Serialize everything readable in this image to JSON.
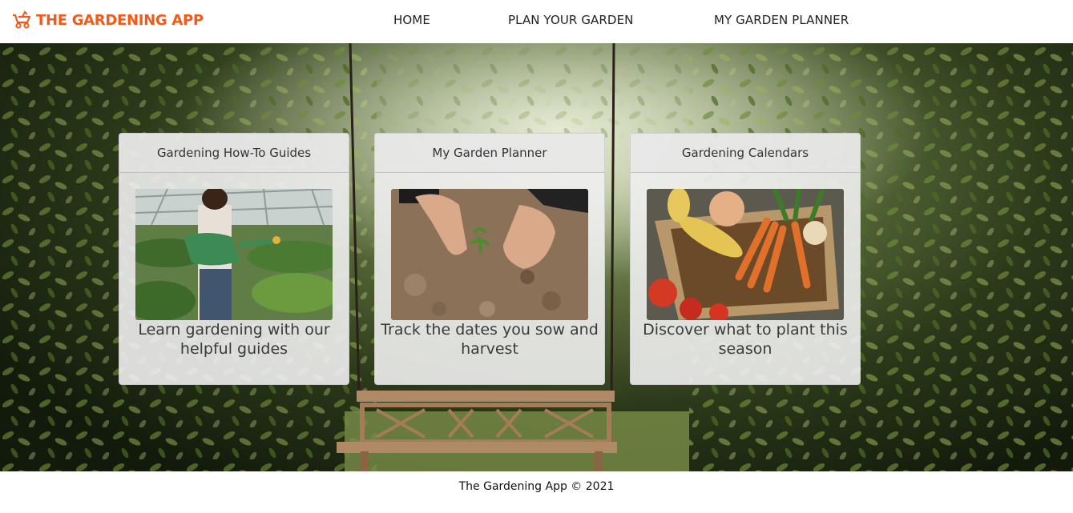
{
  "brand": {
    "name": "THE GARDENING APP",
    "icon": "gardening-wheelbarrow-icon",
    "color": "#f05a1a"
  },
  "nav": {
    "items": [
      {
        "label": "HOME"
      },
      {
        "label": "PLAN YOUR GARDEN"
      },
      {
        "label": "MY GARDEN PLANNER"
      }
    ]
  },
  "cards": [
    {
      "title": "Gardening How-To Guides",
      "text": "Learn gardening with our helpful guides",
      "image": "woman-watering-greenhouse-photo"
    },
    {
      "title": "My Garden Planner",
      "text": "Track the dates you sow and harvest",
      "image": "hands-planting-seedling-photo"
    },
    {
      "title": "Gardening Calendars",
      "text": "Discover what to plant this season",
      "image": "vegetable-basket-photo"
    }
  ],
  "footer": {
    "text": "The Gardening App © 2021"
  }
}
